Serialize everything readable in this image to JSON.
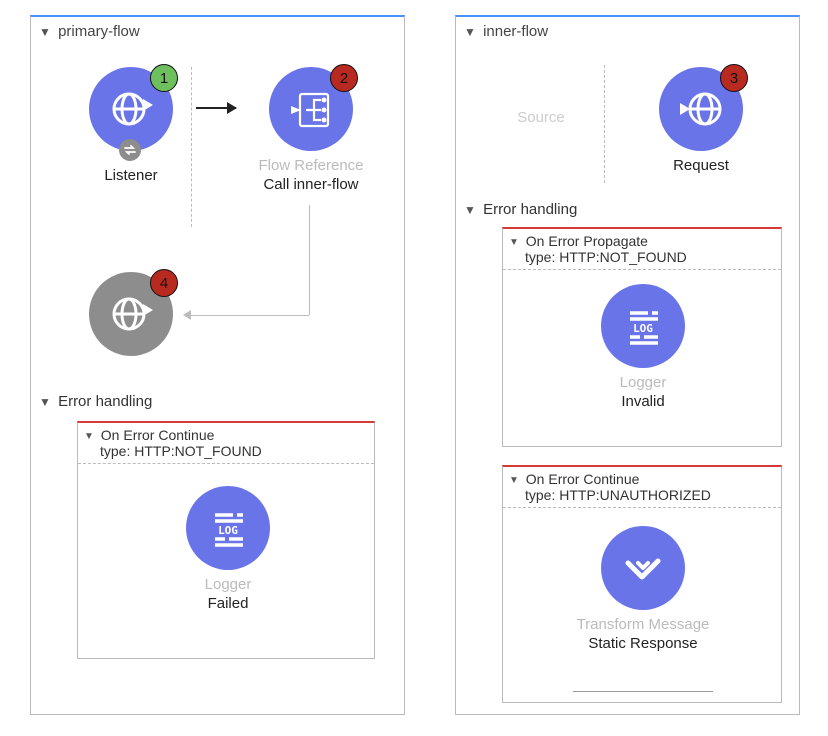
{
  "left": {
    "flow_name": "primary-flow",
    "listener": {
      "label": "Listener",
      "badge": "1"
    },
    "flow_ref": {
      "label_top": "Flow Reference",
      "label_bottom": "Call inner-flow",
      "badge": "2"
    },
    "response": {
      "badge": "4"
    },
    "error_section": "Error handling",
    "handler1": {
      "title": "On Error Continue",
      "type_line": "type: HTTP:NOT_FOUND",
      "logger_label": "Logger",
      "logger_name": "Failed"
    }
  },
  "right": {
    "flow_name": "inner-flow",
    "source_placeholder": "Source",
    "request": {
      "label": "Request",
      "badge": "3"
    },
    "error_section": "Error handling",
    "handler1": {
      "title": "On Error Propagate",
      "type_line": "type: HTTP:NOT_FOUND",
      "logger_label": "Logger",
      "logger_name": "Invalid"
    },
    "handler2": {
      "title": "On Error Continue",
      "type_line": "type: HTTP:UNAUTHORIZED",
      "tx_label": "Transform Message",
      "tx_name": "Static Response"
    }
  }
}
